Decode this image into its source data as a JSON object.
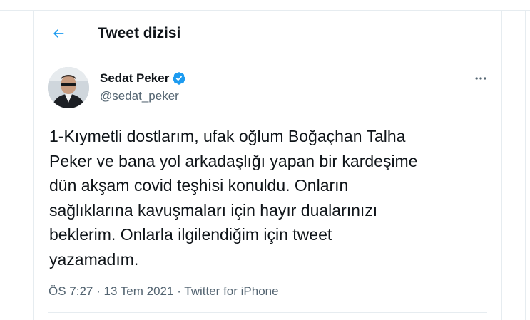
{
  "header": {
    "title": "Tweet dizisi",
    "back_icon": "arrow-left-icon"
  },
  "tweet": {
    "author": {
      "name": "Sedat Peker",
      "handle": "@sedat_peker",
      "verified": true,
      "avatar_icon": "avatar"
    },
    "text": "1-Kıymetli dostlarım, ufak oğlum Boğaçhan Talha\nPeker ve bana yol arkadaşlığı yapan bir kardeşime\ndün akşam covid teşhisi konuldu. Onların\nsağlıklarına kavuşmaları için hayır dualarınızı\nbeklerim. Onlarla ilgilendiğim için tweet\nyazamadım.",
    "time": "ÖS 7:27",
    "separator": " · ",
    "date": "13 Tem 2021",
    "source": "Twitter for iPhone"
  },
  "colors": {
    "accent": "#1d9bf0",
    "text_primary": "#0f1419",
    "text_secondary": "#536471",
    "divider": "#e6ecf0"
  }
}
